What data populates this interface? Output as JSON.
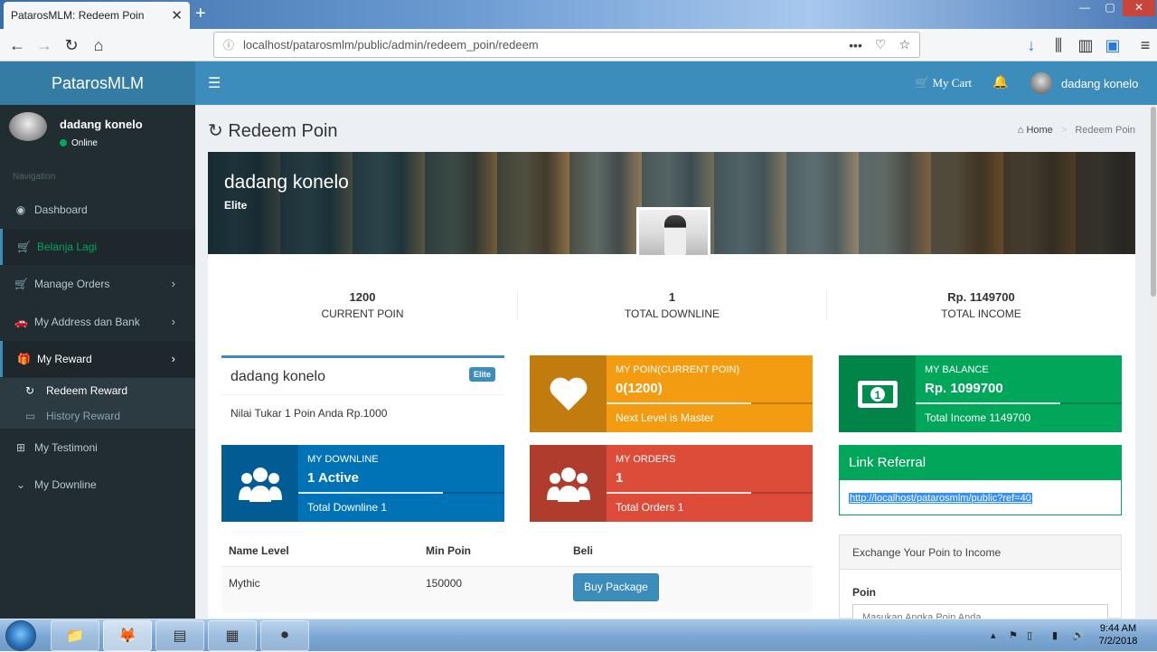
{
  "browser": {
    "tab_title": "PatarosMLM: Redeem Poin",
    "url_host": "localhost",
    "url_path": "/patarosmlm/public/admin/redeem_poin/redeem"
  },
  "header": {
    "logo": "PatarosMLM",
    "cart_label": "My Cart",
    "user_name": "dadang konelo"
  },
  "sidebar": {
    "user_name": "dadang konelo",
    "status": "Online",
    "nav_header": "Navigation",
    "items": [
      {
        "label": "Dashboard",
        "icon": "dashboard-icon"
      },
      {
        "label": "Belanja Lagi",
        "icon": "cart-icon"
      },
      {
        "label": "Manage Orders",
        "icon": "cart-icon"
      },
      {
        "label": "My Address dan Bank",
        "icon": "car-icon"
      },
      {
        "label": "My Reward",
        "icon": "gift-icon"
      },
      {
        "label": "My Testimoni",
        "icon": "plus-square-icon"
      },
      {
        "label": "My Downline",
        "icon": "chevron-down-icon"
      }
    ],
    "subitems": [
      {
        "label": "Redeem Reward",
        "icon": "refresh-icon"
      },
      {
        "label": "History Reward",
        "icon": "money-icon"
      }
    ]
  },
  "page": {
    "title": "Redeem Poin",
    "breadcrumb_home": "Home",
    "breadcrumb_current": "Redeem Poin"
  },
  "profile": {
    "name": "dadang konelo",
    "level": "Elite"
  },
  "stats": [
    {
      "value": "1200",
      "label": "CURRENT POIN"
    },
    {
      "value": "1",
      "label": "TOTAL DOWNLINE"
    },
    {
      "value": "Rp. 1149700",
      "label": "TOTAL INCOME"
    }
  ],
  "userbox": {
    "name": "dadang konelo",
    "badge": "Elite",
    "note": "Nilai Tukar 1 Poin Anda Rp.1000"
  },
  "infoboxes": [
    {
      "title": "MY POIN(CURRENT POIN)",
      "value": "0(1200)",
      "footer": "Next Level is Master",
      "progress": 70,
      "color": "#f39c12",
      "icon": "heart-icon"
    },
    {
      "title": "MY BALANCE",
      "value": "Rp. 1099700",
      "footer": "Total Income 1149700",
      "progress": 70,
      "color": "#00a65a",
      "icon": "money-icon"
    },
    {
      "title": "MY DOWNLINE",
      "value": "1 Active",
      "footer": "Total Downline 1",
      "progress": 70,
      "color": "#0073b7",
      "icon": "users-icon"
    },
    {
      "title": "MY ORDERS",
      "value": "1",
      "footer": "Total Orders 1",
      "progress": 70,
      "color": "#dd4b39",
      "icon": "users-icon"
    }
  ],
  "referral": {
    "title": "Link Referral",
    "link": "http://localhost/patarosmlm/public?ref=40"
  },
  "levels_table": {
    "headers": [
      "Name Level",
      "Min Poin",
      "Beli"
    ],
    "rows": [
      {
        "name": "Mythic",
        "min_poin": "150000",
        "action": "Buy Package"
      }
    ]
  },
  "exchange": {
    "title": "Exchange Your Poin to Income",
    "field_label": "Poin",
    "placeholder": "Masukan Angka Poin Anda"
  },
  "taskbar": {
    "time": "9:44 AM",
    "date": "7/2/2018"
  }
}
